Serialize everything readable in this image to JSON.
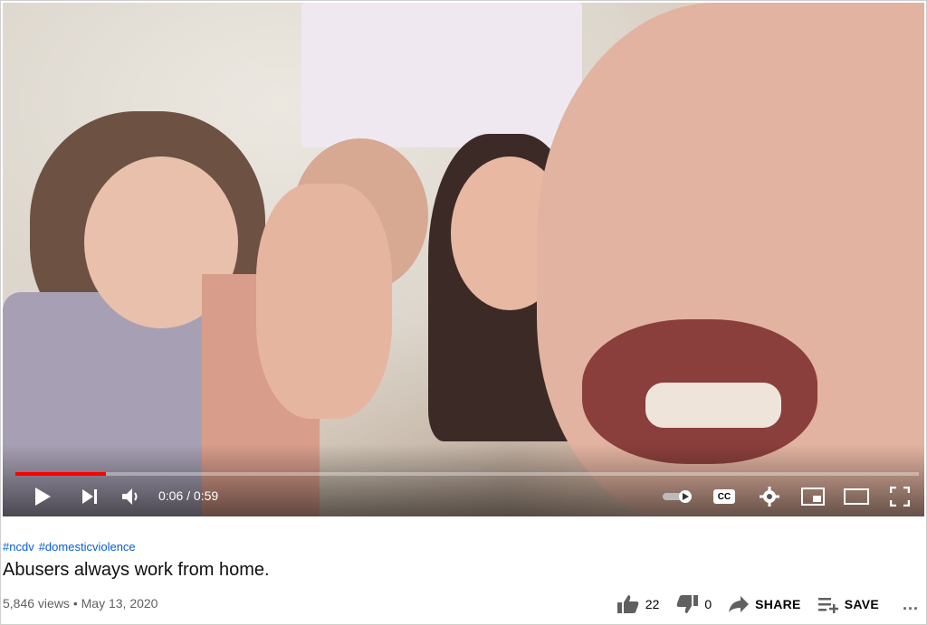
{
  "player": {
    "time_current": "0:06",
    "time_separator": "/",
    "time_total": "0:59",
    "progress_fraction": 0.1,
    "icons": {
      "play": "play-icon",
      "next": "next-icon",
      "volume": "volume-icon",
      "autoplay": "autoplay-toggle-icon",
      "captions": "cc-icon",
      "settings": "gear-icon",
      "miniplayer": "miniplayer-icon",
      "theater": "theater-icon",
      "fullscreen": "fullscreen-icon"
    },
    "captions_label": "CC",
    "progress_color": "#ff0000"
  },
  "video": {
    "hashtags": [
      "#ncdv",
      "#domesticviolence"
    ],
    "title": "Abusers always work from home.",
    "views": "5,846 views",
    "separator": "•",
    "date": "May 13, 2020"
  },
  "actions": {
    "likes": "22",
    "dislikes": "0",
    "share_label": "SHARE",
    "save_label": "SAVE",
    "more_label": "..."
  }
}
